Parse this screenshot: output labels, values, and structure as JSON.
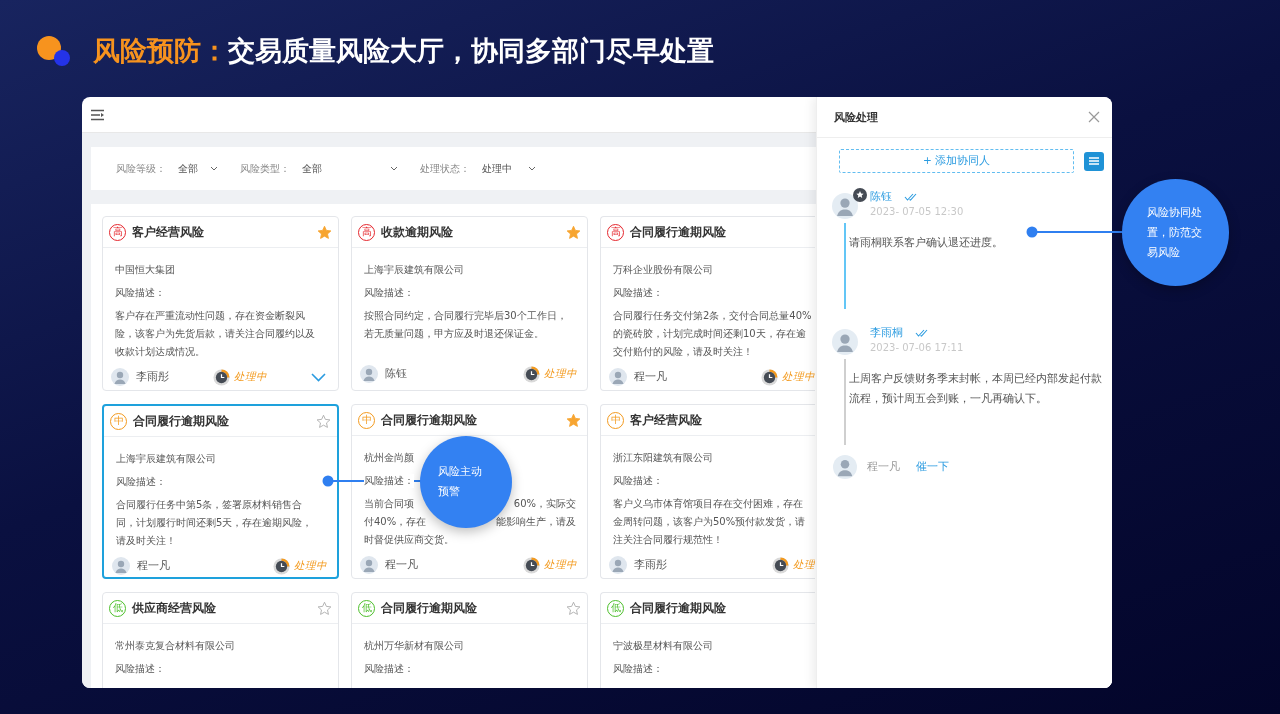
{
  "slide_title": {
    "highlight": "风险预防：",
    "rest": "交易质量风险大厅，协同多部门尽早处置"
  },
  "filters": [
    {
      "label": "风险等级：",
      "value": "全部"
    },
    {
      "label": "风险类型：",
      "value": "全部"
    },
    {
      "label": "处理状态：",
      "value": "处理中"
    }
  ],
  "cards": [
    {
      "kind": "high",
      "level": "高",
      "title": "客户经营风险",
      "starred": true,
      "selected": false,
      "company": "中国恒大集团",
      "desc_label": "风险描述：",
      "desc_lines": [
        [
          "客户存在严重流动性问题，存在资金断裂风"
        ],
        [
          "险，该客户为先货后款，请关注合同履约以及"
        ],
        [
          "收款计划达成情况。"
        ]
      ],
      "owner": "李雨彤",
      "status": "处理中",
      "expandable": true
    },
    {
      "kind": "high",
      "level": "高",
      "title": "收款逾期风险",
      "starred": true,
      "selected": false,
      "company": "上海宇辰建筑有限公司",
      "desc_label": "风险描述：",
      "desc_lines": [
        [
          "按照合同约定，合同履行完毕后30个工作日，"
        ],
        [
          "若无质量问题，甲方应及时退还保证金。"
        ]
      ],
      "owner": "陈钰",
      "status": "处理中",
      "expandable": false
    },
    {
      "kind": "high",
      "level": "高",
      "title": "合同履行逾期风险",
      "selected": false,
      "company": "万科企业股份有限公司",
      "desc_label": "风险描述：",
      "desc_lines": [
        [
          "合同履行任务交付第2条，交付合同总量40%"
        ],
        [
          "的瓷砖胶，计划完成时间还剩10天，存在逾"
        ],
        [
          "交付赔付的风险，请及时关注！"
        ]
      ],
      "owner": "程一凡",
      "status": "处理中",
      "expandable": false
    },
    {
      "kind": "medium",
      "level": "中",
      "title": "合同履行逾期风险",
      "starred": false,
      "selected": true,
      "company": "上海宇辰建筑有限公司",
      "desc_label": "风险描述：",
      "desc_lines": [
        [
          "合同履行任务中第5条，签署原材料销售合"
        ],
        [
          "同，计划履行时间还剩5天，存在逾期风险，"
        ],
        [
          "请及时关注！"
        ]
      ],
      "owner": "程一凡",
      "status": "处理中",
      "expandable": false
    },
    {
      "kind": "medium",
      "level": "中",
      "title": "合同履行逾期风险",
      "starred": true,
      "selected": false,
      "company": "杭州金尚颜",
      "desc_label": "风险描述：",
      "desc_lines": [
        [
          "当前合同项",
          "60%，实际交"
        ],
        [
          "付40%，存在",
          "能影响生产，请及"
        ],
        [
          "时督促供应商交货。"
        ]
      ],
      "owner": "程一凡",
      "status": "处理中",
      "expandable": false
    },
    {
      "kind": "medium",
      "level": "中",
      "title": "客户经营风险",
      "selected": false,
      "company": "浙江东阳建筑有限公司",
      "desc_label": "风险描述：",
      "desc_lines": [
        [
          "客户义乌市体育馆项目存在交付困难，存在"
        ],
        [
          "金周转问题，该客户为50%预付款发货，请"
        ],
        [
          "注关注合同履行规范性！"
        ]
      ],
      "owner": "李雨彤",
      "status": "处理",
      "expandable": false
    },
    {
      "kind": "low",
      "level": "低",
      "title": "供应商经营风险",
      "starred": false,
      "selected": false,
      "company": "常州泰克复合材料有限公司",
      "desc_label": "风险描述："
    },
    {
      "kind": "low",
      "level": "低",
      "title": "合同履行逾期风险",
      "starred": false,
      "selected": false,
      "company": "杭州万华新材有限公司",
      "desc_label": "风险描述："
    },
    {
      "kind": "low",
      "level": "低",
      "title": "合同履行逾期风险",
      "selected": false,
      "company": "宁波极星材料有限公司",
      "desc_label": "风险描述："
    }
  ],
  "panel": {
    "title": "风险处理",
    "add_button": "+ 添加协同人",
    "comments": [
      {
        "name": "陈钰",
        "time": "2023- 07-05 12:30",
        "read": true,
        "starred": true,
        "done": true,
        "text": "请雨桐联系客户确认退还进度。"
      },
      {
        "name": "李雨桐",
        "time": "2023- 07-06 17:11",
        "read": true,
        "starred": false,
        "done": false,
        "text": "上周客户反馈财务季末封帐，本周已经内部发起付款流程，预计周五会到账，一凡再确认下。"
      }
    ],
    "pending": {
      "name": "程一凡",
      "action": "催一下"
    }
  },
  "callouts": [
    {
      "text": "风险主动预警",
      "kind": "left"
    },
    {
      "text": "风险协同处置，防范交易风险",
      "kind": "right"
    }
  ]
}
